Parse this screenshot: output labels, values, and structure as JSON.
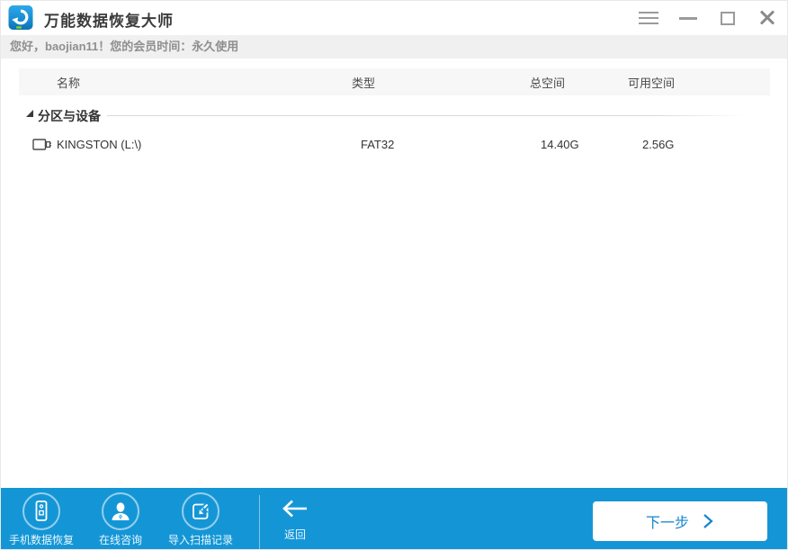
{
  "window": {
    "title": "万能数据恢复大师",
    "controls": [
      "menu",
      "minimize",
      "maximize",
      "close"
    ]
  },
  "greeting": {
    "text": "您好，baojian11！您的会员时间：永久使用"
  },
  "table": {
    "columns": [
      "名称",
      "类型",
      "总空间",
      "可用空间"
    ],
    "section": {
      "label": "分区与设备",
      "state": "expanded"
    },
    "rows": [
      {
        "name": "KINGSTON (L:\\)",
        "type": "FAT32",
        "total": "14.40G",
        "free": "2.56G"
      }
    ]
  },
  "footer": {
    "actions": [
      {
        "label": "手机数据恢复",
        "icon": "phone-icon"
      },
      {
        "label": "在线咨询",
        "icon": "person-icon"
      },
      {
        "label": "导入扫描记录",
        "icon": "import-icon"
      }
    ],
    "back": {
      "label": "返回",
      "icon": "left-arrow-icon"
    },
    "next": {
      "label": "下一步",
      "icon": "chevron-right-icon"
    }
  },
  "icons": {
    "logo": "recovery-disk",
    "menu": "hamburger-lines",
    "minimize": "dash",
    "maximize": "square-outline",
    "close": "x-cross",
    "tree_expanded": "lower-right-triangle",
    "device": "usb-flash-drive"
  },
  "colors": {
    "footer_blue": "#1496d6",
    "button_text_blue": "#1585cb",
    "header_bg": "#f7f7f7",
    "greeting_bg": "#f0f0f0",
    "greeting_text": "#8f8f8f",
    "logo_blue": "#1b8fd6",
    "logo_led_green": "#7ed321"
  }
}
